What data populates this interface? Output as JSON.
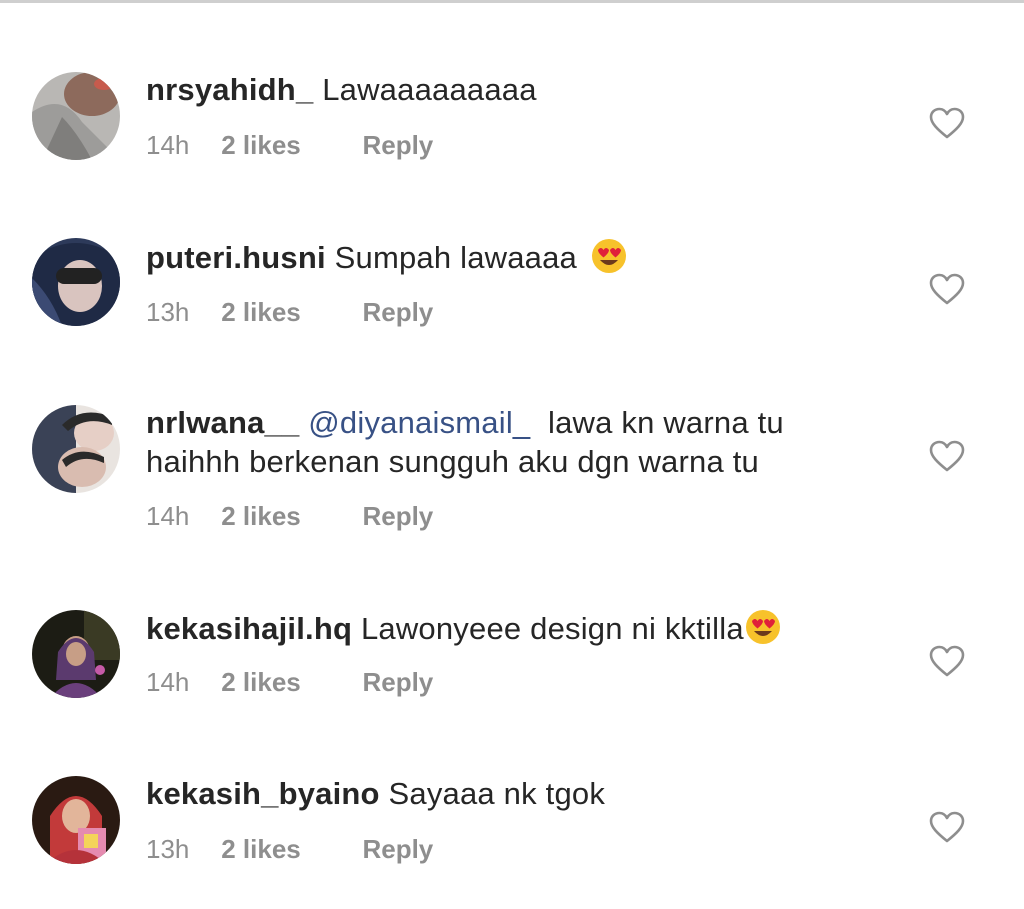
{
  "comments": [
    {
      "username": "nrsyahidh_",
      "mention": "",
      "text": "Lawaaaaaaaaa",
      "text_line2": "",
      "emoji": "",
      "time": "14h",
      "likes": "2 likes",
      "reply": "Reply"
    },
    {
      "username": "puteri.husni",
      "mention": "",
      "text": "Sumpah lawaaaa",
      "text_line2": "",
      "emoji": "heart-eyes-emoji",
      "time": "13h",
      "likes": "2 likes",
      "reply": "Reply"
    },
    {
      "username": "nrlwana__",
      "mention": "@diyanaismail_",
      "text": "lawa kn warna tu",
      "text_line2": "haihhh berkenan sungguh aku dgn warna tu",
      "emoji": "",
      "time": "14h",
      "likes": "2 likes",
      "reply": "Reply"
    },
    {
      "username": "kekasihajil.hq",
      "mention": "",
      "text": "Lawonyeee design ni kktilla",
      "text_line2": "",
      "emoji": "heart-eyes-emoji",
      "time": "14h",
      "likes": "2 likes",
      "reply": "Reply"
    },
    {
      "username": "kekasih_byaino",
      "mention": "",
      "text": "Sayaaa nk tgok",
      "text_line2": "",
      "emoji": "",
      "time": "13h",
      "likes": "2 likes",
      "reply": "Reply"
    }
  ],
  "icons": {
    "like": "heart-outline-icon",
    "emoji": "heart-eyes-emoji"
  },
  "colors": {
    "username": "#262626",
    "mention": "#385185",
    "meta": "#8e8e8e",
    "heart_outline": "#8e8e8e"
  }
}
